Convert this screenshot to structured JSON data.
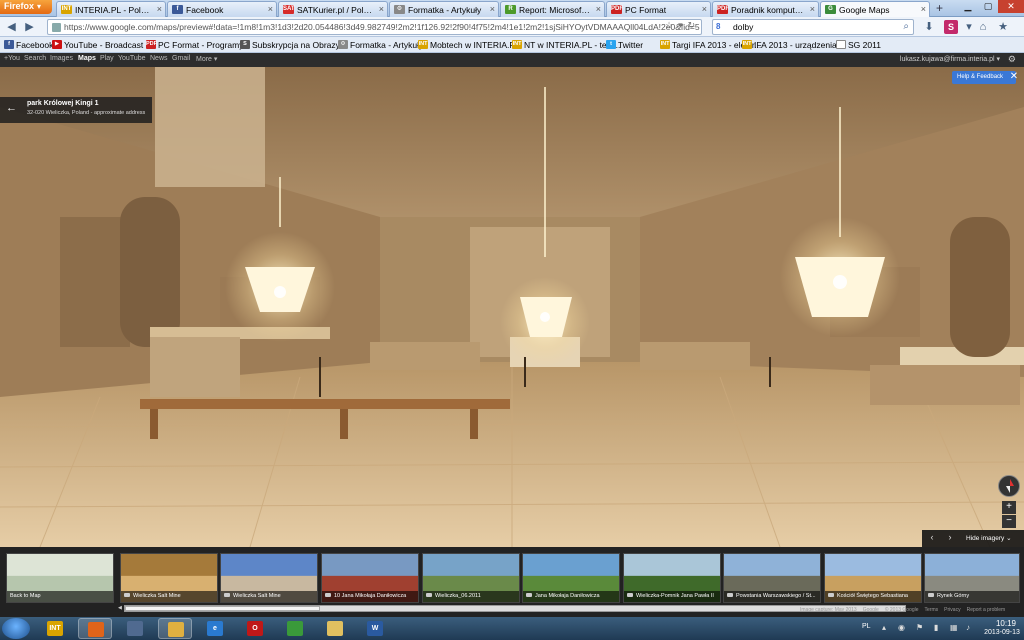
{
  "browser": {
    "menu_label": "Firefox",
    "tabs": [
      {
        "label": "INTERIA.PL - Polska i ś...",
        "icon_text": "INT",
        "icon_color": "#d9a400"
      },
      {
        "label": "Facebook",
        "icon_text": "f",
        "icon_color": "#3b5998"
      },
      {
        "label": "SATKurier.pl / Polonica ...",
        "icon_text": "SAT",
        "icon_color": "#d62b2b"
      },
      {
        "label": "Formatka - Artykuły",
        "icon_text": "⚙",
        "icon_color": "#888888"
      },
      {
        "label": "Report: Microsoft Worki...",
        "icon_text": "R",
        "icon_color": "#4c9a2a"
      },
      {
        "label": "PC Format",
        "icon_text": "PDF",
        "icon_color": "#cc2222"
      },
      {
        "label": "Poradnik komputerowy...",
        "icon_text": "PDF",
        "icon_color": "#cc2222"
      },
      {
        "label": "Google Maps",
        "icon_text": "G",
        "icon_color": "#3b8c3b"
      }
    ],
    "new_tab_label": "+",
    "url": "https://www.google.com/maps/preview#!data=!1m8!1m3!1d3!2d20.054486!3d49.982749!2m2!1f126.92!2f90!4f75!2m4!1e1!2m2!1sjSiHYOytVDMAAAQll04LdA!2e0&fid=5",
    "search_value": "dolby",
    "bookmarks": [
      {
        "label": "Facebook",
        "icon_text": "f",
        "icon_color": "#3b5998"
      },
      {
        "label": "YouTube - Broadcast ...",
        "icon_text": "▶",
        "icon_color": "#cc1111"
      },
      {
        "label": "PC Format - Programy...",
        "icon_text": "PDF",
        "icon_color": "#cc2222"
      },
      {
        "label": "Subskrypcja na Obrazy...",
        "icon_text": "S",
        "icon_color": "#555555"
      },
      {
        "label": "Formatka - Artykuły",
        "icon_text": "⚙",
        "icon_color": "#888888"
      },
      {
        "label": "Mobtech w INTERIA.P...",
        "icon_text": "INT",
        "icon_color": "#d9a400"
      },
      {
        "label": "NT w INTERIA.PL - test...",
        "icon_text": "INT",
        "icon_color": "#d9a400"
      },
      {
        "label": "Twitter",
        "icon_text": "t",
        "icon_color": "#2aa3ef"
      },
      {
        "label": "Targi IFA 2013 - elektr...",
        "icon_text": "INT",
        "icon_color": "#d9a400"
      },
      {
        "label": "IFA 2013 - urządzenia ...",
        "icon_text": "INT",
        "icon_color": "#d9a400"
      },
      {
        "label": "SG 2011",
        "icon_text": "",
        "icon_color": "#ffffff"
      }
    ]
  },
  "gbar": {
    "links": [
      "+You",
      "Search",
      "Images",
      "Maps",
      "Play",
      "YouTube",
      "News",
      "Gmail",
      "More ▾"
    ],
    "active_index": 3,
    "user": "lukasz.kujawa@firma.interia.pl ▾"
  },
  "streetview": {
    "place_name": "park Królowej Kingi 1",
    "place_address": "32-020 Wieliczka, Poland - approximate address",
    "help_label": "Help & Feedback",
    "zoom_in": "+",
    "zoom_out": "−"
  },
  "filmstrip": {
    "hide_label": "Hide imagery",
    "thumbs": [
      {
        "caption": "Back to Map",
        "has_camera": false,
        "bg": "#dde4d6",
        "accent": "#b6c6ad"
      },
      {
        "caption": "Wieliczka Salt Mine",
        "has_camera": true,
        "bg": "#a57a3a",
        "accent": "#d8b070"
      },
      {
        "caption": "Wieliczka Salt Mine",
        "has_camera": true,
        "bg": "#5d86c8",
        "accent": "#c8b8a0"
      },
      {
        "caption": "10 Jana Mikołaja Daniłowicza",
        "has_camera": true,
        "bg": "#7899c2",
        "accent": "#a04030"
      },
      {
        "caption": "Wieliczka_06.2011",
        "has_camera": true,
        "bg": "#77a3c8",
        "accent": "#6a8a4a"
      },
      {
        "caption": "Jana Mikołaja Daniłowicza",
        "has_camera": true,
        "bg": "#6aa0d0",
        "accent": "#5a8a3a"
      },
      {
        "caption": "Wieliczka-Pomnik Jana Pawła II",
        "has_camera": true,
        "bg": "#aac6d8",
        "accent": "#3f6a2a"
      },
      {
        "caption": "Powstania Warszawskiego / St...",
        "has_camera": true,
        "bg": "#8fb2d8",
        "accent": "#6a6a5a"
      },
      {
        "caption": "Kościół Świętego Sebastiana",
        "has_camera": true,
        "bg": "#9bbbe0",
        "accent": "#c8a060"
      },
      {
        "caption": "Rynek Górny",
        "has_camera": true,
        "bg": "#8cb0d8",
        "accent": "#8a8a80"
      }
    ],
    "scroll_fraction": 0.25,
    "footer": [
      "Image capture: May 2013",
      "Google",
      "© 2013 Google",
      "Terms",
      "Privacy",
      "Report a problem"
    ]
  },
  "taskbar": {
    "apps": [
      {
        "name": "interia-icon",
        "text": "INT",
        "color": "#d9a400",
        "open": false
      },
      {
        "name": "firefox-icon",
        "text": "",
        "color": "#e0641a",
        "open": true
      },
      {
        "name": "screenshot-icon",
        "text": "",
        "color": "#506a90",
        "open": false
      },
      {
        "name": "notes-icon",
        "text": "",
        "color": "#e0b040",
        "open": true
      },
      {
        "name": "ie-icon",
        "text": "e",
        "color": "#2a7ad0",
        "open": false
      },
      {
        "name": "opera-icon",
        "text": "O",
        "color": "#c01818",
        "open": false
      },
      {
        "name": "chrome-icon",
        "text": "",
        "color": "#3a9a3a",
        "open": false
      },
      {
        "name": "folder-icon",
        "text": "",
        "color": "#e0c060",
        "open": false
      },
      {
        "name": "word-icon",
        "text": "W",
        "color": "#2a5aa0",
        "open": false
      }
    ],
    "lang": "PL",
    "time": "10:19",
    "date": "2013-09-13"
  }
}
